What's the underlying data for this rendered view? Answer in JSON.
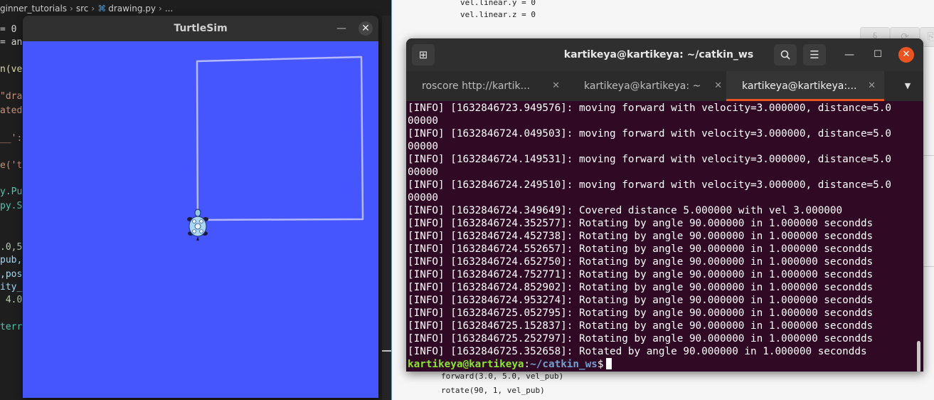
{
  "editor": {
    "breadcrumb": [
      "ginner_tutorials",
      "src",
      "drawing.py",
      "..."
    ],
    "code_fragments": [
      {
        "text": "= 0",
        "color": "#d4d4d4"
      },
      {
        "text": "= an",
        "color": "#d4d4d4"
      },
      {
        "text": "n(ve",
        "color": "#dcdcaa"
      },
      {
        "text": "\"dra",
        "color": "#ce9178"
      },
      {
        "text": "ated",
        "color": "#ce9178"
      },
      {
        "text": "__':",
        "color": "#ce9178"
      },
      {
        "text": "e('t",
        "color": "#ce9178"
      },
      {
        "text": "y.Pu",
        "color": "#4ec9b0"
      },
      {
        "text": "py.S",
        "color": "#4ec9b0"
      },
      {
        "text": ".0,5",
        "color": "#b5cea8"
      },
      {
        "text": "pub,",
        "color": "#9cdcfe"
      },
      {
        "text": ",pos",
        "color": "#9cdcfe"
      },
      {
        "text": "ity_",
        "color": "#9cdcfe"
      },
      {
        "text": " 4.0",
        "color": "#b5cea8"
      },
      {
        "text": "terr",
        "color": "#4ec9b0"
      }
    ]
  },
  "doc": {
    "code_top": [
      "vel.linear.y = 0",
      "vel.linear.z = 0"
    ],
    "code_bottom": [
      "forward(3.0, 5.0, vel_pub)",
      "rotate(90, 1, vel_pub)"
    ]
  },
  "turtlesim": {
    "title": "TurtleSim",
    "background": "#4556ff",
    "pen_color": "#b3b8ff"
  },
  "terminal": {
    "title": "kartikeya@kartikeya: ~/catkin_ws",
    "tabs": [
      {
        "label": "roscore http://kartik...",
        "active": false
      },
      {
        "label": "kartikeya@kartikeya: ~",
        "active": false
      },
      {
        "label": "kartikeya@kartikeya:...",
        "active": true
      }
    ],
    "lines": [
      "[INFO] [1632846723.949576]: moving forward with velocity=3.000000, distance=5.0",
      "00000",
      "[INFO] [1632846724.049503]: moving forward with velocity=3.000000, distance=5.0",
      "00000",
      "[INFO] [1632846724.149531]: moving forward with velocity=3.000000, distance=5.0",
      "00000",
      "[INFO] [1632846724.249510]: moving forward with velocity=3.000000, distance=5.0",
      "00000",
      "[INFO] [1632846724.349649]: Covered distance 5.000000 with vel 3.000000",
      "[INFO] [1632846724.352577]: Rotating by angle 90.000000 in 1.000000 secondds",
      "[INFO] [1632846724.452738]: Rotating by angle 90.000000 in 1.000000 secondds",
      "[INFO] [1632846724.552657]: Rotating by angle 90.000000 in 1.000000 secondds",
      "[INFO] [1632846724.652750]: Rotating by angle 90.000000 in 1.000000 secondds",
      "[INFO] [1632846724.752771]: Rotating by angle 90.000000 in 1.000000 secondds",
      "[INFO] [1632846724.852902]: Rotating by angle 90.000000 in 1.000000 secondds",
      "[INFO] [1632846724.953274]: Rotating by angle 90.000000 in 1.000000 secondds",
      "[INFO] [1632846725.052795]: Rotating by angle 90.000000 in 1.000000 secondds",
      "[INFO] [1632846725.152837]: Rotating by angle 90.000000 in 1.000000 secondds",
      "[INFO] [1632846725.252797]: Rotating by angle 90.000000 in 1.000000 secondds",
      "[INFO] [1632846725.352658]: Rotated by angle 90.000000 in 1.000000 secondds"
    ],
    "prompt_user": "kartikeya@kartikeya",
    "prompt_sep": ":",
    "prompt_path": "~/catkin_ws",
    "prompt_symbol": "$",
    "colors": {
      "background": "#300a24",
      "accent": "#e95420",
      "user": "#8ae234",
      "path": "#729fcf"
    }
  }
}
